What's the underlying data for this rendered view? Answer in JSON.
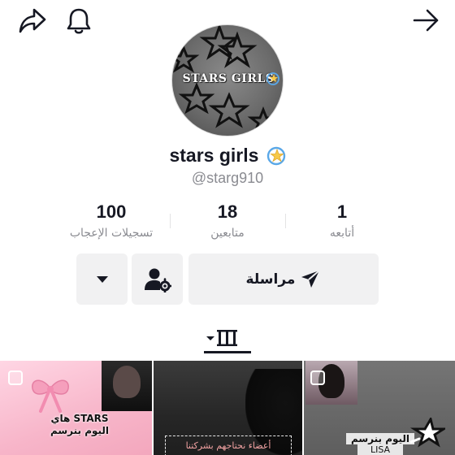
{
  "icons": {
    "share": "share-icon",
    "bell": "bell-icon",
    "back": "arrow-right-icon",
    "avatar_badge": "dizzy-star-emoji",
    "name_badge": "dizzy-star-emoji",
    "dropdown": "caret-down-icon",
    "friends": "user-gear-icon",
    "message": "send-plane-icon",
    "videos_tab": "grid-bars-icon"
  },
  "avatar": {
    "text": "STARS GIRLS"
  },
  "profile": {
    "display_name": "stars girls",
    "username": "@starg910"
  },
  "stats": {
    "likes": {
      "value": "100",
      "label": "تسجيلات الإعجاب"
    },
    "followers": {
      "value": "18",
      "label": "متابعين"
    },
    "following": {
      "value": "1",
      "label": "أتابعه"
    }
  },
  "actions": {
    "message_label": "مراسلة"
  },
  "videos": [
    {
      "caption_line1": "هاي STARS",
      "caption_line2": "اليوم بنرسم"
    },
    {
      "caption": "أعضاء نحتاجهم بشركتنا"
    },
    {
      "caption_line1": "اليوم بنرسم",
      "caption_line2": "LISA"
    }
  ],
  "colors": {
    "text_primary": "#161823",
    "text_secondary": "#8a8b91",
    "button_bg": "#f1f1f2",
    "tile_pink": "#f7b5c9"
  }
}
